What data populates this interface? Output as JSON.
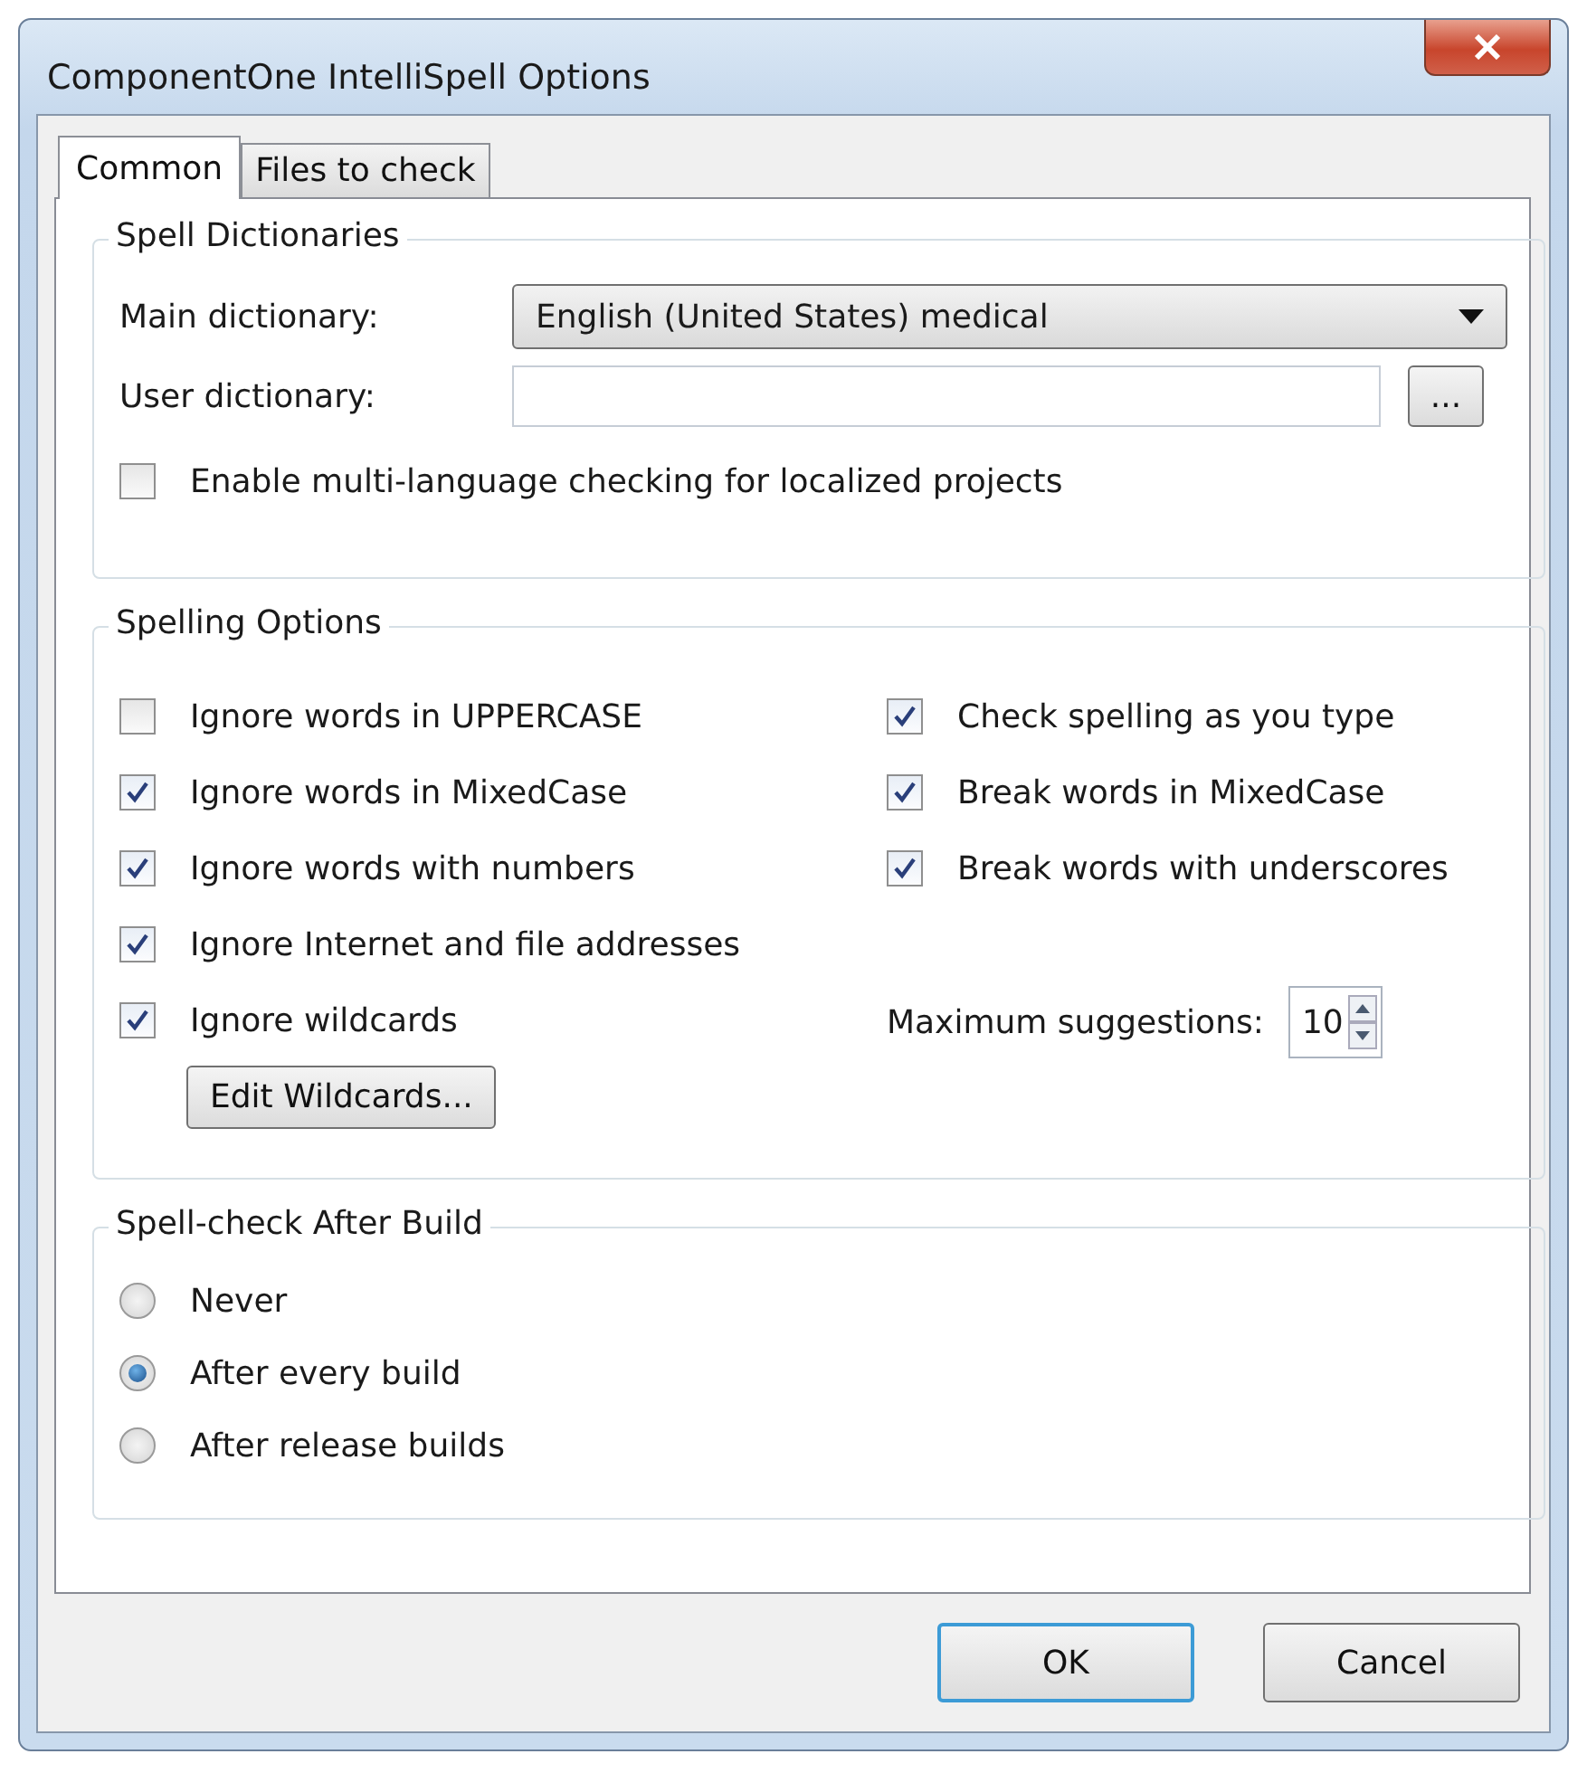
{
  "window": {
    "title": "ComponentOne IntelliSpell Options"
  },
  "tabs": [
    {
      "label": "Common",
      "selected": true
    },
    {
      "label": "Files to check",
      "selected": false
    }
  ],
  "spell_dictionaries": {
    "title": "Spell Dictionaries",
    "main_dictionary": {
      "label": "Main dictionary:",
      "value": "English (United States) medical"
    },
    "user_dictionary": {
      "label": "User dictionary:",
      "browse_button": "..."
    },
    "multi_language": {
      "label": "Enable multi-language checking for localized projects",
      "checked": false
    }
  },
  "spelling_options": {
    "title": "Spelling Options",
    "left": [
      {
        "label": "Ignore words in UPPERCASE",
        "checked": false
      },
      {
        "label": "Ignore words in MixedCase",
        "checked": true
      },
      {
        "label": "Ignore words with numbers",
        "checked": true
      },
      {
        "label": "Ignore Internet and file addresses",
        "checked": true
      },
      {
        "label": "Ignore wildcards",
        "checked": true
      }
    ],
    "edit_wildcards_button": "Edit Wildcards...",
    "right": [
      {
        "label": "Check spelling as you type",
        "checked": true
      },
      {
        "label": "Break words in MixedCase",
        "checked": true
      },
      {
        "label": "Break words with underscores",
        "checked": true
      }
    ],
    "max_suggestions": {
      "label": "Maximum suggestions:",
      "value": "10"
    }
  },
  "after_build": {
    "title": "Spell-check After Build",
    "options": [
      {
        "label": "Never",
        "selected": false
      },
      {
        "label": "After every build",
        "selected": true
      },
      {
        "label": "After release builds",
        "selected": false
      }
    ]
  },
  "buttons": [
    {
      "label": "OK",
      "default": true
    },
    {
      "label": "Cancel",
      "default": false
    }
  ]
}
